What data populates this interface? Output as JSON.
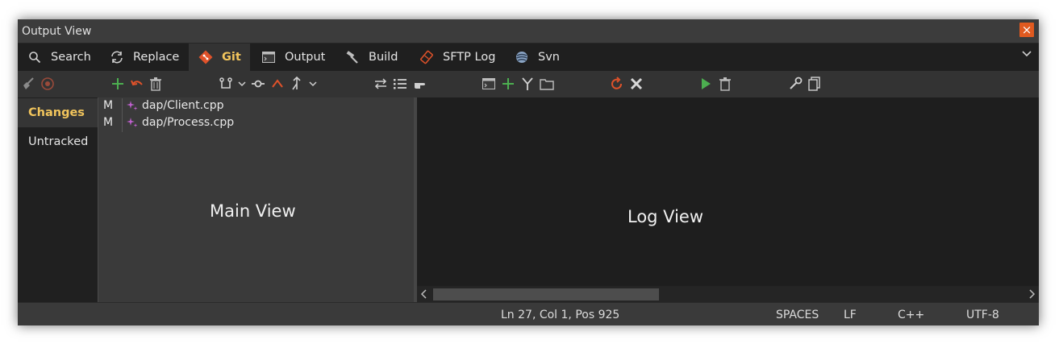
{
  "window": {
    "title": "Output View",
    "close_symbol": "×"
  },
  "tabs": [
    {
      "label": "Search",
      "icon": "search-icon"
    },
    {
      "label": "Replace",
      "icon": "replace-icon"
    },
    {
      "label": "Git",
      "icon": "git-icon",
      "active": true
    },
    {
      "label": "Output",
      "icon": "terminal-icon"
    },
    {
      "label": "Build",
      "icon": "hammer-icon"
    },
    {
      "label": "SFTP Log",
      "icon": "sftp-icon"
    },
    {
      "label": "Svn",
      "icon": "svn-icon"
    }
  ],
  "left_nav": [
    {
      "label": "Changes",
      "active": true
    },
    {
      "label": "Untracked"
    }
  ],
  "files": [
    {
      "status": "M",
      "name": "dap/Client.cpp"
    },
    {
      "status": "M",
      "name": "dap/Process.cpp"
    }
  ],
  "main_view_label": "Main View",
  "log_view_label": "Log View",
  "status": {
    "position": "Ln 27, Col 1, Pos 925",
    "indent": "SPACES",
    "eol": "LF",
    "language": "C++",
    "encoding": "UTF-8"
  },
  "colors": {
    "accent": "#f2c55c",
    "close": "#e05a20",
    "add": "#4caf50",
    "undo": "#e0522a",
    "run": "#4caf50"
  }
}
